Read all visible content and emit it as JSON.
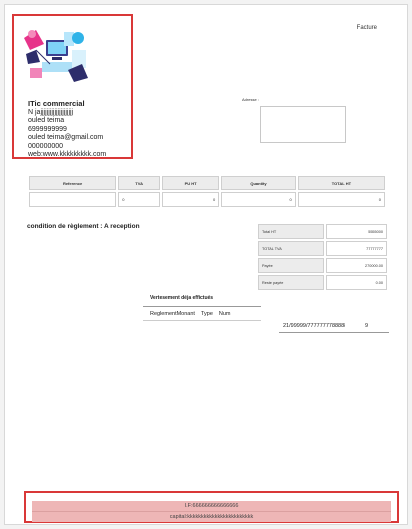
{
  "document": {
    "title": "Facture"
  },
  "company": {
    "name": "ITic commercial",
    "line1": "N jajjjjjjjjjjjjjjjjjjjjj",
    "owner": "ouled teima",
    "phone": "6999999999",
    "email": "ouled teima@gmail.com",
    "fax": "000000000",
    "web": "web:www.kkkkkkkkk.com"
  },
  "address": {
    "label": "Adresse :",
    "value": ""
  },
  "items_table": {
    "headers": [
      "Reference",
      "TVA",
      "PU HT",
      "Quantity",
      "TOTAL HT"
    ],
    "rows": [
      {
        "reference": "",
        "tva": "0",
        "pu_ht": "0",
        "quantity": "0",
        "total_ht": "0"
      }
    ]
  },
  "conditions": "condition de règlement : A reception",
  "totals": [
    {
      "label": "Total HT",
      "value": "5555000"
    },
    {
      "label": "TOTAL TVA",
      "value": "77777777"
    },
    {
      "label": "Payée",
      "value": "270000.00"
    },
    {
      "label": "Reste payée",
      "value": "0.00"
    }
  ],
  "versements": {
    "title": "Vertesement déja effictués",
    "headers": [
      "ReglementMonant",
      "Type",
      "Num"
    ],
    "row": {
      "amount": "21/99999/77777777888888",
      "type": "",
      "num": "9"
    }
  },
  "footer": {
    "line1": "I.F:666666666666666",
    "line2": "capital:kkkkkkkkkkkkkkkkkkkkkkkk"
  },
  "colors": {
    "highlight_border": "#d93838",
    "footer_fill": "#eeb6b6"
  }
}
